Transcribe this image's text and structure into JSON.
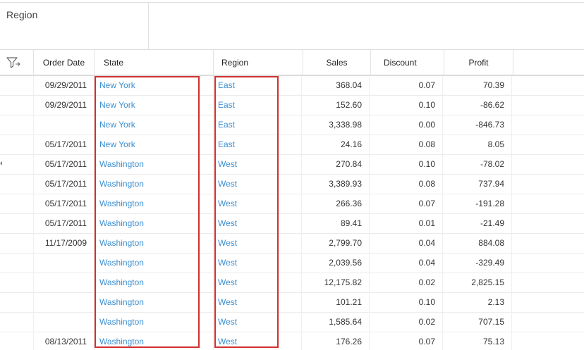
{
  "filter_panel": {
    "title": "Region"
  },
  "table": {
    "filter_icon": "filter-icon",
    "columns": [
      "Order Date",
      "State",
      "Region",
      "Sales",
      "Discount",
      "Profit"
    ],
    "rows": [
      [
        "09/29/2011",
        "New York",
        "East",
        "368.04",
        "0.07",
        "70.39"
      ],
      [
        "09/29/2011",
        "New York",
        "East",
        "152.60",
        "0.10",
        "-86.62"
      ],
      [
        "",
        "New York",
        "East",
        "3,338.98",
        "0.00",
        "-846.73"
      ],
      [
        "05/17/2011",
        "New York",
        "East",
        "24.16",
        "0.08",
        "8.05"
      ],
      [
        "05/17/2011",
        "Washington",
        "West",
        "270.84",
        "0.10",
        "-78.02"
      ],
      [
        "05/17/2011",
        "Washington",
        "West",
        "3,389.93",
        "0.08",
        "737.94"
      ],
      [
        "05/17/2011",
        "Washington",
        "West",
        "266.36",
        "0.07",
        "-191.28"
      ],
      [
        "05/17/2011",
        "Washington",
        "West",
        "89.41",
        "0.01",
        "-21.49"
      ],
      [
        "11/17/2009",
        "Washington",
        "West",
        "2,799.70",
        "0.04",
        "884.08"
      ],
      [
        "",
        "Washington",
        "West",
        "2,039.56",
        "0.04",
        "-329.49"
      ],
      [
        "",
        "Washington",
        "West",
        "12,175.82",
        "0.02",
        "2,825.15"
      ],
      [
        "",
        "Washington",
        "West",
        "101.21",
        "0.10",
        "2.13"
      ],
      [
        "",
        "Washington",
        "West",
        "1,585.64",
        "0.02",
        "707.15"
      ],
      [
        "08/13/2011",
        "Washington",
        "West",
        "176.26",
        "0.07",
        "75.13"
      ]
    ]
  },
  "colors": {
    "link": "#3d8fd1",
    "highlight": "#d32f2f"
  }
}
